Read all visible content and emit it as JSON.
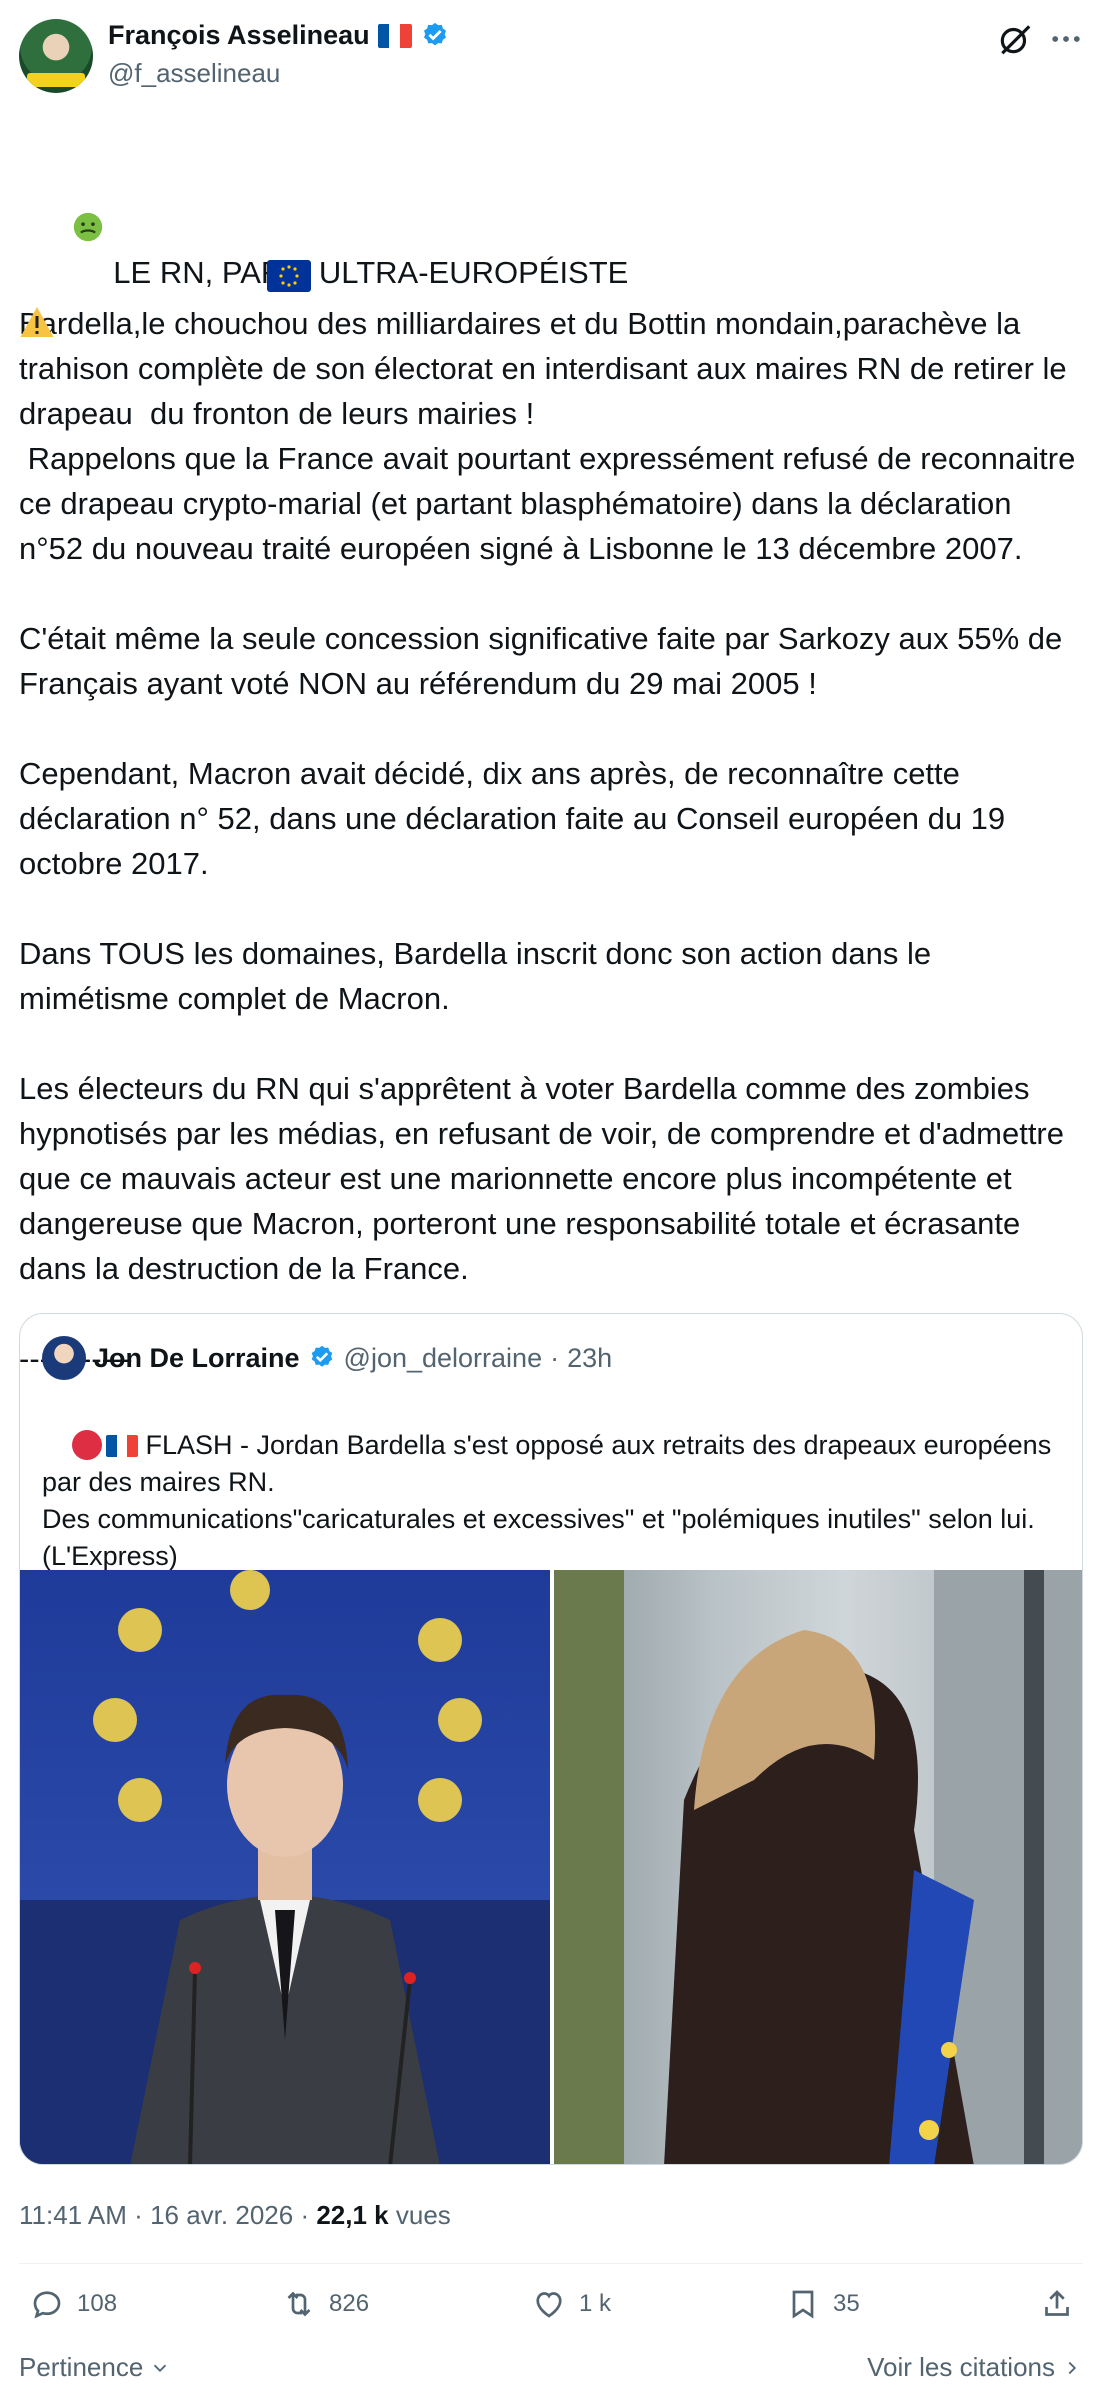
{
  "author": {
    "name": "François Asselineau",
    "handle": "@f_asselineau",
    "avatar_text": "ASSELINEAU 2027"
  },
  "post": {
    "text": " LE RN, PARTI ULTRA-EUROPÉISTE\nBardella,le chouchou des milliardaires et du Bottin mondain,parachève la trahison complète de son électorat en interdisant aux maires RN de retirer le drapeau  du fronton de leurs mairies !\n Rappelons que la France avait pourtant expressément refusé de reconnaitre ce drapeau crypto-marial (et partant blasphématoire) dans la déclaration n°52 du nouveau traité européen signé à Lisbonne le 13 décembre 2007.\n\nC'était même la seule concession significative faite par Sarkozy aux 55% de Français ayant voté NON au référendum du 29 mai 2005 !\n\nCependant, Macron avait décidé, dix ans après, de reconnaître cette déclaration n° 52, dans une déclaration faite au Conseil européen du 19 octobre 2017.\n\nDans TOUS les domaines, Bardella inscrit donc son action dans le mimétisme complet de Macron.\n\nLes électeurs du RN qui s'apprêtent à voter Bardella comme des zombies hypnotisés par les médias, en refusant de voir, de comprendre et d'admettre que ce mauvais acteur est une marionnette encore plus incompétente et dangereuse que Macron, porteront une responsabilité totale et écrasante dans la destruction de la France.\n\n-----------"
  },
  "quote": {
    "name": "Jon De Lorraine",
    "handle": "@jon_delorraine",
    "sep": "·",
    "time": "23h",
    "text": " FLASH - Jordan Bardella s'est opposé aux retraits des drapeaux européens par des maires RN.\nDes communications\"caricaturales et excessives\" et \"polémiques inutiles\" selon lui. (L'Express)"
  },
  "meta": {
    "time": "11:41 AM",
    "sep": "·",
    "date": "16 avr. 2026",
    "views": "22,1 k",
    "views_label": "vues"
  },
  "actions": {
    "replies": "108",
    "reposts": "826",
    "likes": "1 k",
    "bookmarks": "35"
  },
  "footer": {
    "sort_label": "Pertinence",
    "quotes_link": "Voir les citations"
  },
  "colors": {
    "blue_verified": "#1d9bf0",
    "text": "#0f1419",
    "secondary": "#536471",
    "border": "#cfd9de"
  }
}
